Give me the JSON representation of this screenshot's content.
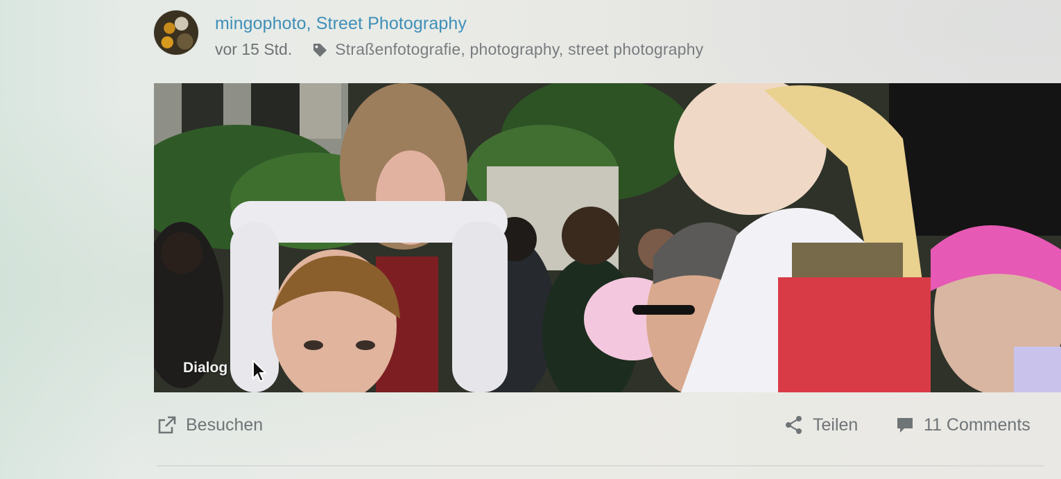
{
  "post": {
    "author": "mingophoto, Street Photography",
    "time": "vor 15 Std.",
    "tags": "Straßenfotografie, photography, street photography"
  },
  "image": {
    "caption": "Dialog"
  },
  "actions": {
    "visit_label": "Besuchen",
    "share_label": "Teilen",
    "comments_label": "11 Comments"
  },
  "icons": {
    "tag": "tag-icon",
    "visit": "external-link-icon",
    "share": "share-icon",
    "comments": "comment-icon",
    "cursor": "cursor-icon"
  },
  "colors": {
    "author_link": "#3f8fb8",
    "meta_text": "#6e7173",
    "action_text": "#6f7477"
  }
}
